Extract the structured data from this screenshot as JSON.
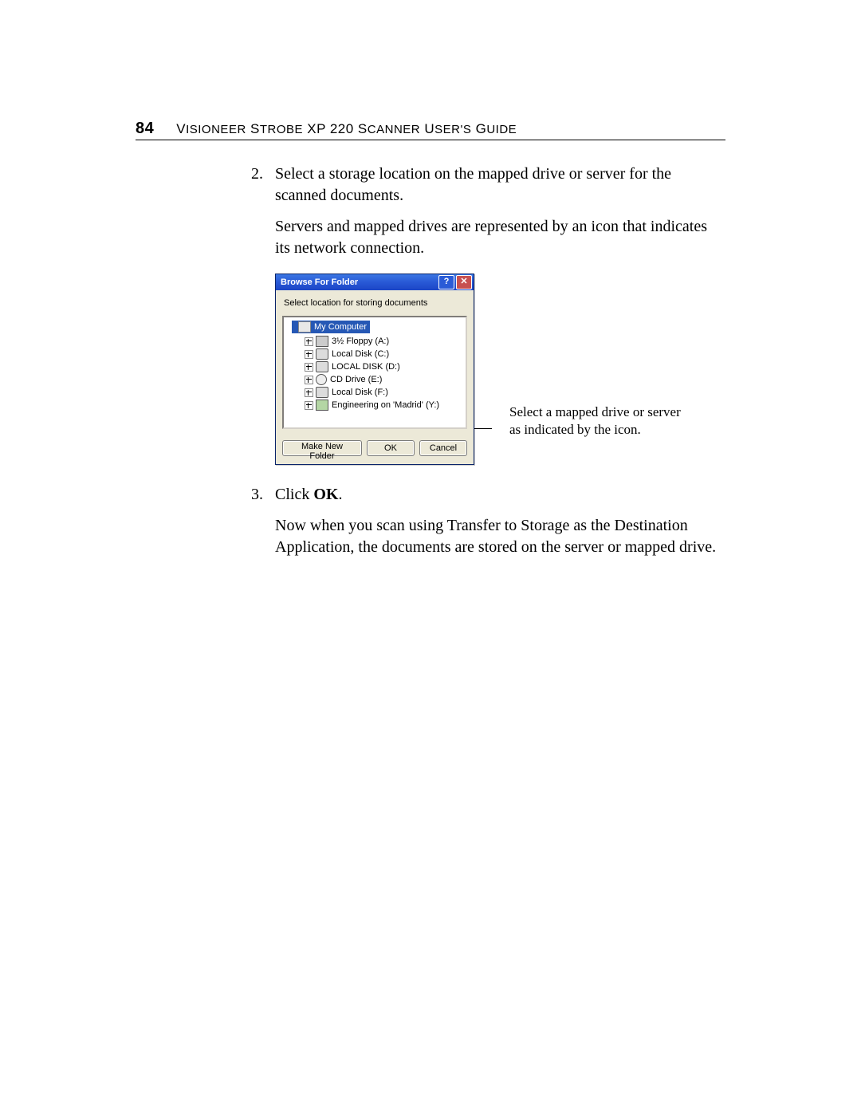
{
  "header": {
    "page_number": "84",
    "running_title_1": "V",
    "running_title_2": "ISIONEER",
    "running_title_3": " S",
    "running_title_4": "TROBE",
    "running_title_5": " XP 220 S",
    "running_title_6": "CANNER",
    "running_title_7": " U",
    "running_title_8": "SER",
    "running_title_9": "'",
    "running_title_10": "S",
    "running_title_11": " G",
    "running_title_12": "UIDE"
  },
  "step2": {
    "number": "2.",
    "text": "Select a storage location on the mapped drive or server for the scanned documents.",
    "para": "Servers and mapped drives are represented by an icon that indicates its network connection."
  },
  "dialog": {
    "title": "Browse For Folder",
    "help_btn": "?",
    "close_btn": "✕",
    "instruction": "Select location for storing documents",
    "root": "My Computer",
    "items": [
      "3½ Floppy (A:)",
      "Local Disk (C:)",
      "LOCAL DISK (D:)",
      "CD Drive (E:)",
      "Local Disk (F:)",
      "Engineering on 'Madrid' (Y:)"
    ],
    "make_new_folder": "Make New Folder",
    "ok": "OK",
    "cancel": "Cancel"
  },
  "callout": "Select a mapped drive or server as indicated by the icon.",
  "step3": {
    "number": "3.",
    "text_prefix": "Click ",
    "text_bold": "OK",
    "text_suffix": ".",
    "para": "Now when you scan using Transfer to Storage as the Destination Application, the documents are stored on the server or mapped drive."
  }
}
